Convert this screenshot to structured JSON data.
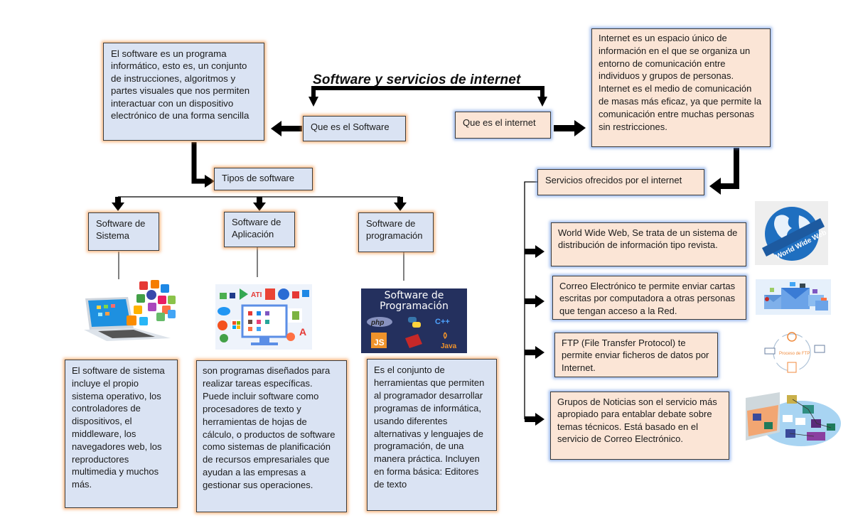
{
  "title": "Software y servicios de internet",
  "software": {
    "node_label": "Que es el Software",
    "definition": "El software es un programa informático, esto es, un conjunto de instrucciones, algoritmos y partes visuales que nos permiten interactuar con un dispositivo electrónico de una forma sencilla",
    "types_label": "Tipos de software",
    "types": [
      {
        "label": "Software de Sistema",
        "image": "laptop-apps-illustration",
        "description": "El software de sistema incluye el propio sistema operativo, los controladores de dispositivos, el middleware, los navegadores web, los reproductores multimedia y muchos más."
      },
      {
        "label": "Software de Aplicación",
        "image": "application-icons-monitor-illustration",
        "description": "son programas diseñados para realizar tareas específicas. Puede incluir software como procesadores de texto y herramientas de hojas de cálculo, o productos de software como sistemas de planificación de recursos empresariales que ayudan a las empresas a gestionar sus operaciones."
      },
      {
        "label": "Software de programación",
        "image": "programming-languages-banner",
        "image_text": {
          "heading_line1": "Software de",
          "heading_line2": "Programación",
          "logos": [
            "php",
            "python",
            "C++",
            "JS",
            "RUBY",
            "Java"
          ]
        },
        "description": "Es el conjunto de herramientas que permiten al programador desarrollar programas de informática, usando diferentes alternativas y lenguajes de programación, de una manera práctica. Incluyen en forma básica: Editores de texto"
      }
    ]
  },
  "internet": {
    "node_label": "Que es el internet",
    "definition": "Internet es un espacio único de información en el que se organiza un entorno de comunicación entre individuos y grupos de personas. Internet es el medio de comunicación de masas más eficaz, ya que permite la comunicación entre muchas personas sin restricciones.",
    "services_label": "Servicios ofrecidos por el internet",
    "services": [
      {
        "text": "World Wide Web, Se trata de un sistema de distribución de información tipo revista.",
        "image": "world-wide-web-globe",
        "image_label": "World Wide Web"
      },
      {
        "text": "Correo Electrónico te permite enviar cartas escritas por computadora a otras personas que tengan acceso a la Red.",
        "image": "email-envelopes"
      },
      {
        "text": "FTP (File Transfer Protocol) te permite enviar ficheros de datos por Internet.",
        "image": "ftp-process-diagram",
        "image_label": "Proceso de FTP"
      },
      {
        "text": "Grupos de Noticias son el servicio más apropiado para entablar debate sobre temas técnicos. Está basado en el servicio de Correo Electrónico.",
        "image": "network-computers-illustration"
      }
    ]
  },
  "colors": {
    "software_box_fill": "#dae3f3",
    "software_box_glow": "#f5a05a",
    "internet_box_fill": "#fbe5d6",
    "internet_box_glow": "#78a0e6",
    "connector": "#000000"
  }
}
